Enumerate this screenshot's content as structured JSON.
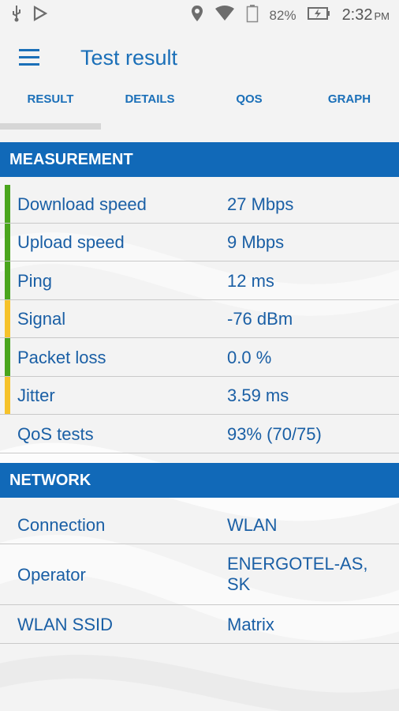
{
  "status_bar": {
    "icons_left": [
      "usb-icon",
      "play-store-icon"
    ],
    "icons_right": [
      "location-icon",
      "wifi-icon",
      "battery-outline-icon",
      "battery-charging-icon"
    ],
    "battery_pct": "82%",
    "time": "2:32",
    "ampm": "PM"
  },
  "app_bar": {
    "title": "Test result"
  },
  "tabs": [
    {
      "label": "RESULT"
    },
    {
      "label": "DETAILS"
    },
    {
      "label": "QOS"
    },
    {
      "label": "GRAPH"
    }
  ],
  "measurement": {
    "header": "MEASUREMENT",
    "rows": [
      {
        "label": "Download speed",
        "value": "27 Mbps",
        "indicator": "#4aa51c"
      },
      {
        "label": "Upload speed",
        "value": "9 Mbps",
        "indicator": "#4aa51c"
      },
      {
        "label": "Ping",
        "value": "12 ms",
        "indicator": "#4aa51c"
      },
      {
        "label": "Signal",
        "value": "-76 dBm",
        "indicator": "#f6c22a"
      },
      {
        "label": "Packet loss",
        "value": "0.0 %",
        "indicator": "#4aa51c"
      },
      {
        "label": "Jitter",
        "value": "3.59 ms",
        "indicator": "#f6c22a"
      },
      {
        "label": "QoS tests",
        "value": "93% (70/75)",
        "indicator": ""
      }
    ]
  },
  "network": {
    "header": "NETWORK",
    "rows": [
      {
        "label": "Connection",
        "value": "WLAN"
      },
      {
        "label": "Operator",
        "value": "ENERGOTEL-AS, SK"
      },
      {
        "label": "WLAN SSID",
        "value": "Matrix"
      }
    ]
  },
  "colors": {
    "accent": "#1a6fb8",
    "section_header": "#1169b8",
    "good": "#4aa51c",
    "warn": "#f6c22a"
  }
}
